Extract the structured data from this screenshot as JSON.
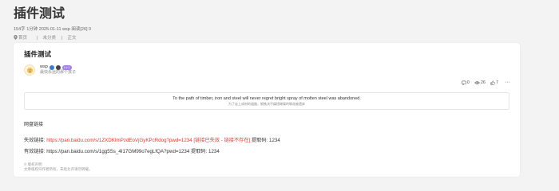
{
  "page": {
    "title": "插件测试",
    "meta": "154字 1分钟 2025-01-11 wsp 阅读[26] 0",
    "breadcrumb": [
      "首页",
      "未分类",
      "正文"
    ]
  },
  "post": {
    "title": "插件测试",
    "author": {
      "name": "wsp",
      "level_badge": "Lv.1",
      "signature": "最快永远的那个孩子"
    },
    "actions": {
      "comments": "0",
      "views": "26",
      "likes": "7"
    },
    "quote": {
      "en": "To the path of timber, iron and steel will never regret bright spray of molten steel was abandoned.",
      "cn": "为了走上成材的道路，钢铁决不痛惜璀璨的钢花被遗弃"
    },
    "section_label": "网盘链接",
    "broken_link": {
      "label": "失效链接:",
      "url": "https://pan.baidu.com/s/1ZXDKImPzdEoVjGyKPcRdog?pwd=1234",
      "status": "[链接已失效 - 链接不存在]",
      "code_label": "提取码:",
      "code": "1234"
    },
    "valid_link": {
      "label": "有效链接:",
      "url": "https://pan.baidu.com/s/1gg5Ss_4I17GM99o7egLfQA?pwd=1234",
      "code_label": "提取码:",
      "code": "1234"
    },
    "notes": [
      "© 版权声明",
      "文章版权归作者所有，未经允许请勿转载。"
    ]
  },
  "colors": {
    "accent_red": "#e53935",
    "level_badge": "#a77ef0"
  }
}
